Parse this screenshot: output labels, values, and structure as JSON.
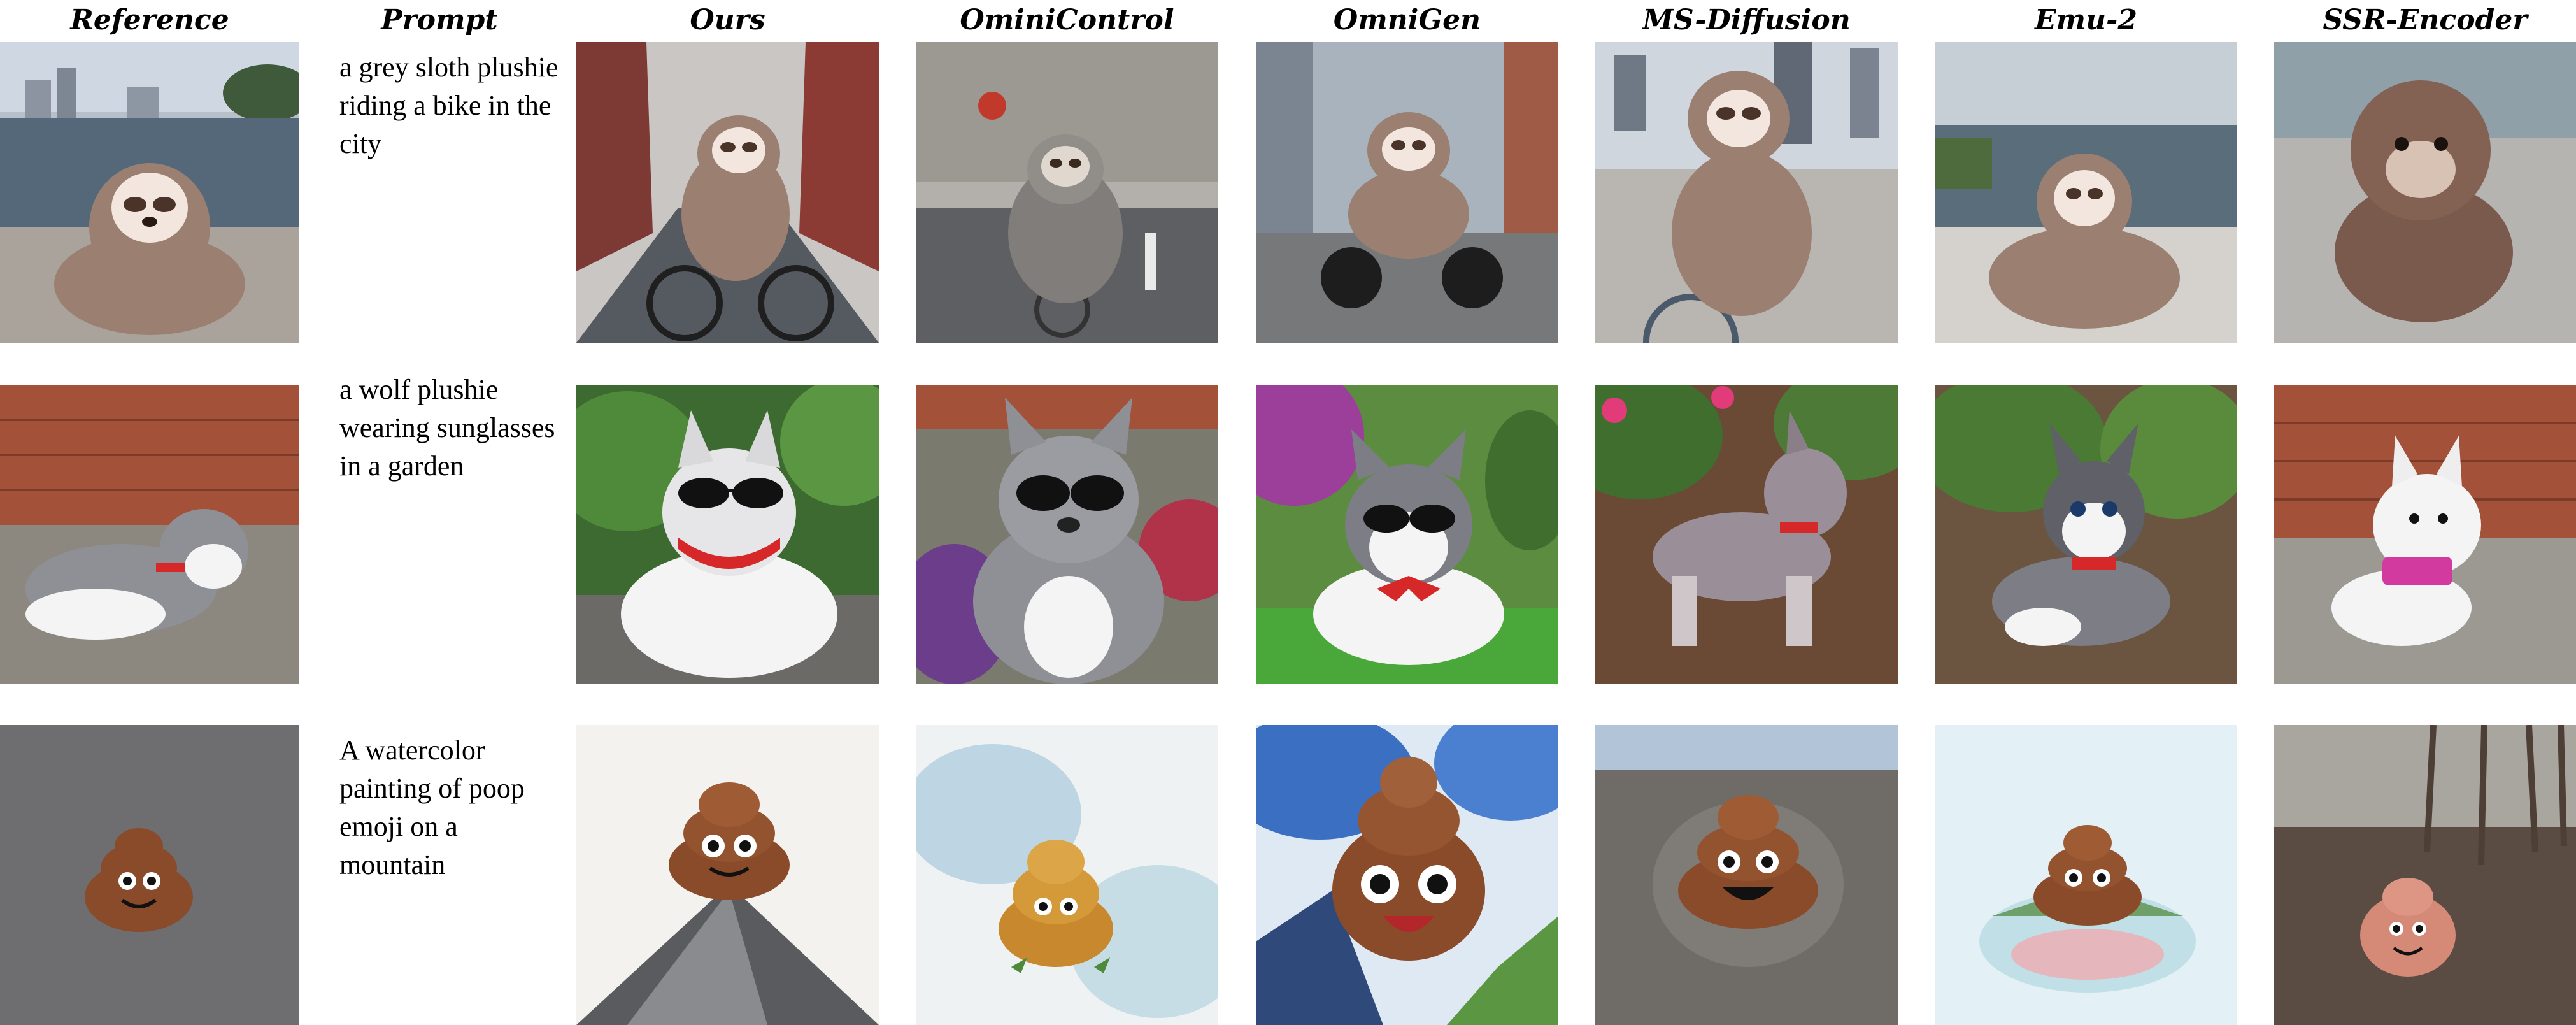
{
  "columns": [
    "Reference",
    "Prompt",
    "Ours",
    "OminiControl",
    "OmniGen",
    "MS-Diffusion",
    "Emu-2",
    "SSR-Encoder"
  ],
  "rows": [
    {
      "prompt": "a grey sloth plushie  riding a bike in the city",
      "subject": "sloth"
    },
    {
      "prompt": "a wolf plushie wearing sunglasses in a garden",
      "subject": "wolf"
    },
    {
      "prompt": "A watercolor painting of poop emoji on a mountain",
      "subject": "poop"
    }
  ],
  "colors": {
    "sloth_fur": "#9b8072",
    "sloth_face": "#f2e6de",
    "wolf_grey": "#8f8f96",
    "wolf_white": "#f4f4f4",
    "scarf_red": "#d62828",
    "poop_brown": "#8a4b2a",
    "sky": "#cdd8e4",
    "grass": "#4f8a3a",
    "brick": "#a4513a",
    "asphalt": "#6e6e70"
  }
}
